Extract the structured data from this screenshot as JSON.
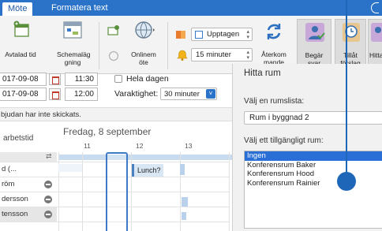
{
  "tabs": {
    "meeting": "Möte",
    "format_text": "Formatera text"
  },
  "ribbon": {
    "scheduled_time": "Avtalad tid",
    "scheduling_line1": "Schemaläg",
    "scheduling_line2": "gning",
    "online_line1": "Onlinem",
    "online_line2": "öte",
    "show_as_value": "Upptagen",
    "reminder_value": "15 minuter",
    "recurrence_line1": "Återkom",
    "recurrence_line2": "mande",
    "request_line1": "Begär",
    "request_line2": "svar",
    "allow_line1": "Tillåt",
    "allow_line2": "förslag",
    "find_label": "Hitta"
  },
  "form": {
    "start_date": "017-09-08",
    "start_time": "11:30",
    "end_date": "017-09-08",
    "end_time": "12:00",
    "all_day_label": "Hela dagen",
    "duration_label": "Varaktighet:",
    "duration_value": "30 minuter",
    "info_bar": "bjudan har inte skickats."
  },
  "schedule": {
    "work_hours_label": "arbetstid",
    "date_header": "Fredag, 8 september",
    "hours": [
      "11",
      "12",
      "13"
    ],
    "event_label": "Lunch?",
    "people": [
      "d (...",
      "röm",
      "dersson",
      "tensson"
    ]
  },
  "room_finder": {
    "title": "Hitta rum",
    "list_label": "Välj en rumslista:",
    "list_value": "Rum i byggnad 2",
    "available_label": "Välj ett tillgängligt rum:",
    "rooms": [
      "Ingen",
      "Konferensrum Baker",
      "Konferensrum Hood",
      "Konferensrum Rainier"
    ]
  },
  "colors": {
    "accent": "#2a73c9",
    "selection": "#2a6fd6",
    "pointer": "#1e66b8"
  }
}
